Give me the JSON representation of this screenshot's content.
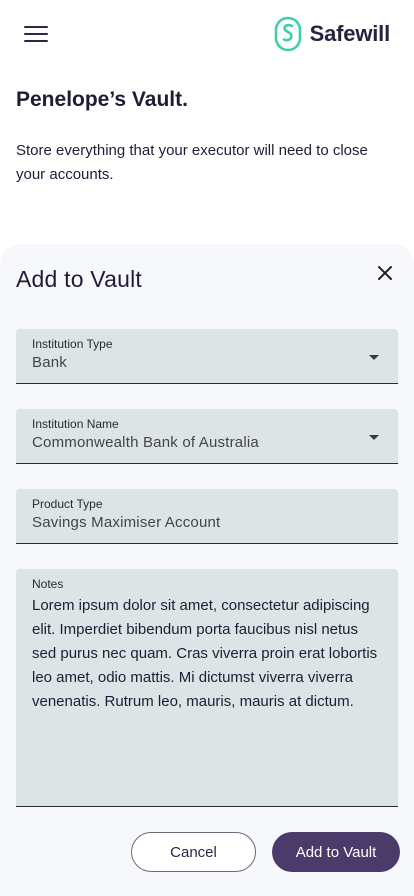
{
  "header": {
    "menu_icon": "hamburger-menu-icon",
    "logo_icon": "safewill-logo-mark",
    "logo_text": "Safewill",
    "brand_color": "#3ecfa6"
  },
  "page": {
    "title": "Penelope’s Vault.",
    "description": "Store everything that your executor will need to close your accounts."
  },
  "sheet": {
    "title": "Add to Vault",
    "close_icon": "close-icon",
    "fields": {
      "institution_type": {
        "label": "Institution Type",
        "value": "Bank"
      },
      "institution_name": {
        "label": "Institution Name",
        "value": "Commonwealth Bank of Australia"
      },
      "product_type": {
        "label": "Product Type",
        "value": "Savings Maximiser Account"
      },
      "notes": {
        "label": "Notes",
        "value": "Lorem ipsum dolor sit amet, consectetur adipiscing elit. Imperdiet bibendum porta faucibus nisl netus sed purus nec quam. Cras viverra proin erat lobortis leo amet, odio mattis. Mi dictumst viverra viverra venenatis. Rutrum leo, mauris, mauris at dictum."
      }
    },
    "cancel_label": "Cancel",
    "submit_label": "Add to Vault",
    "accent_color": "#4a3b6b"
  }
}
